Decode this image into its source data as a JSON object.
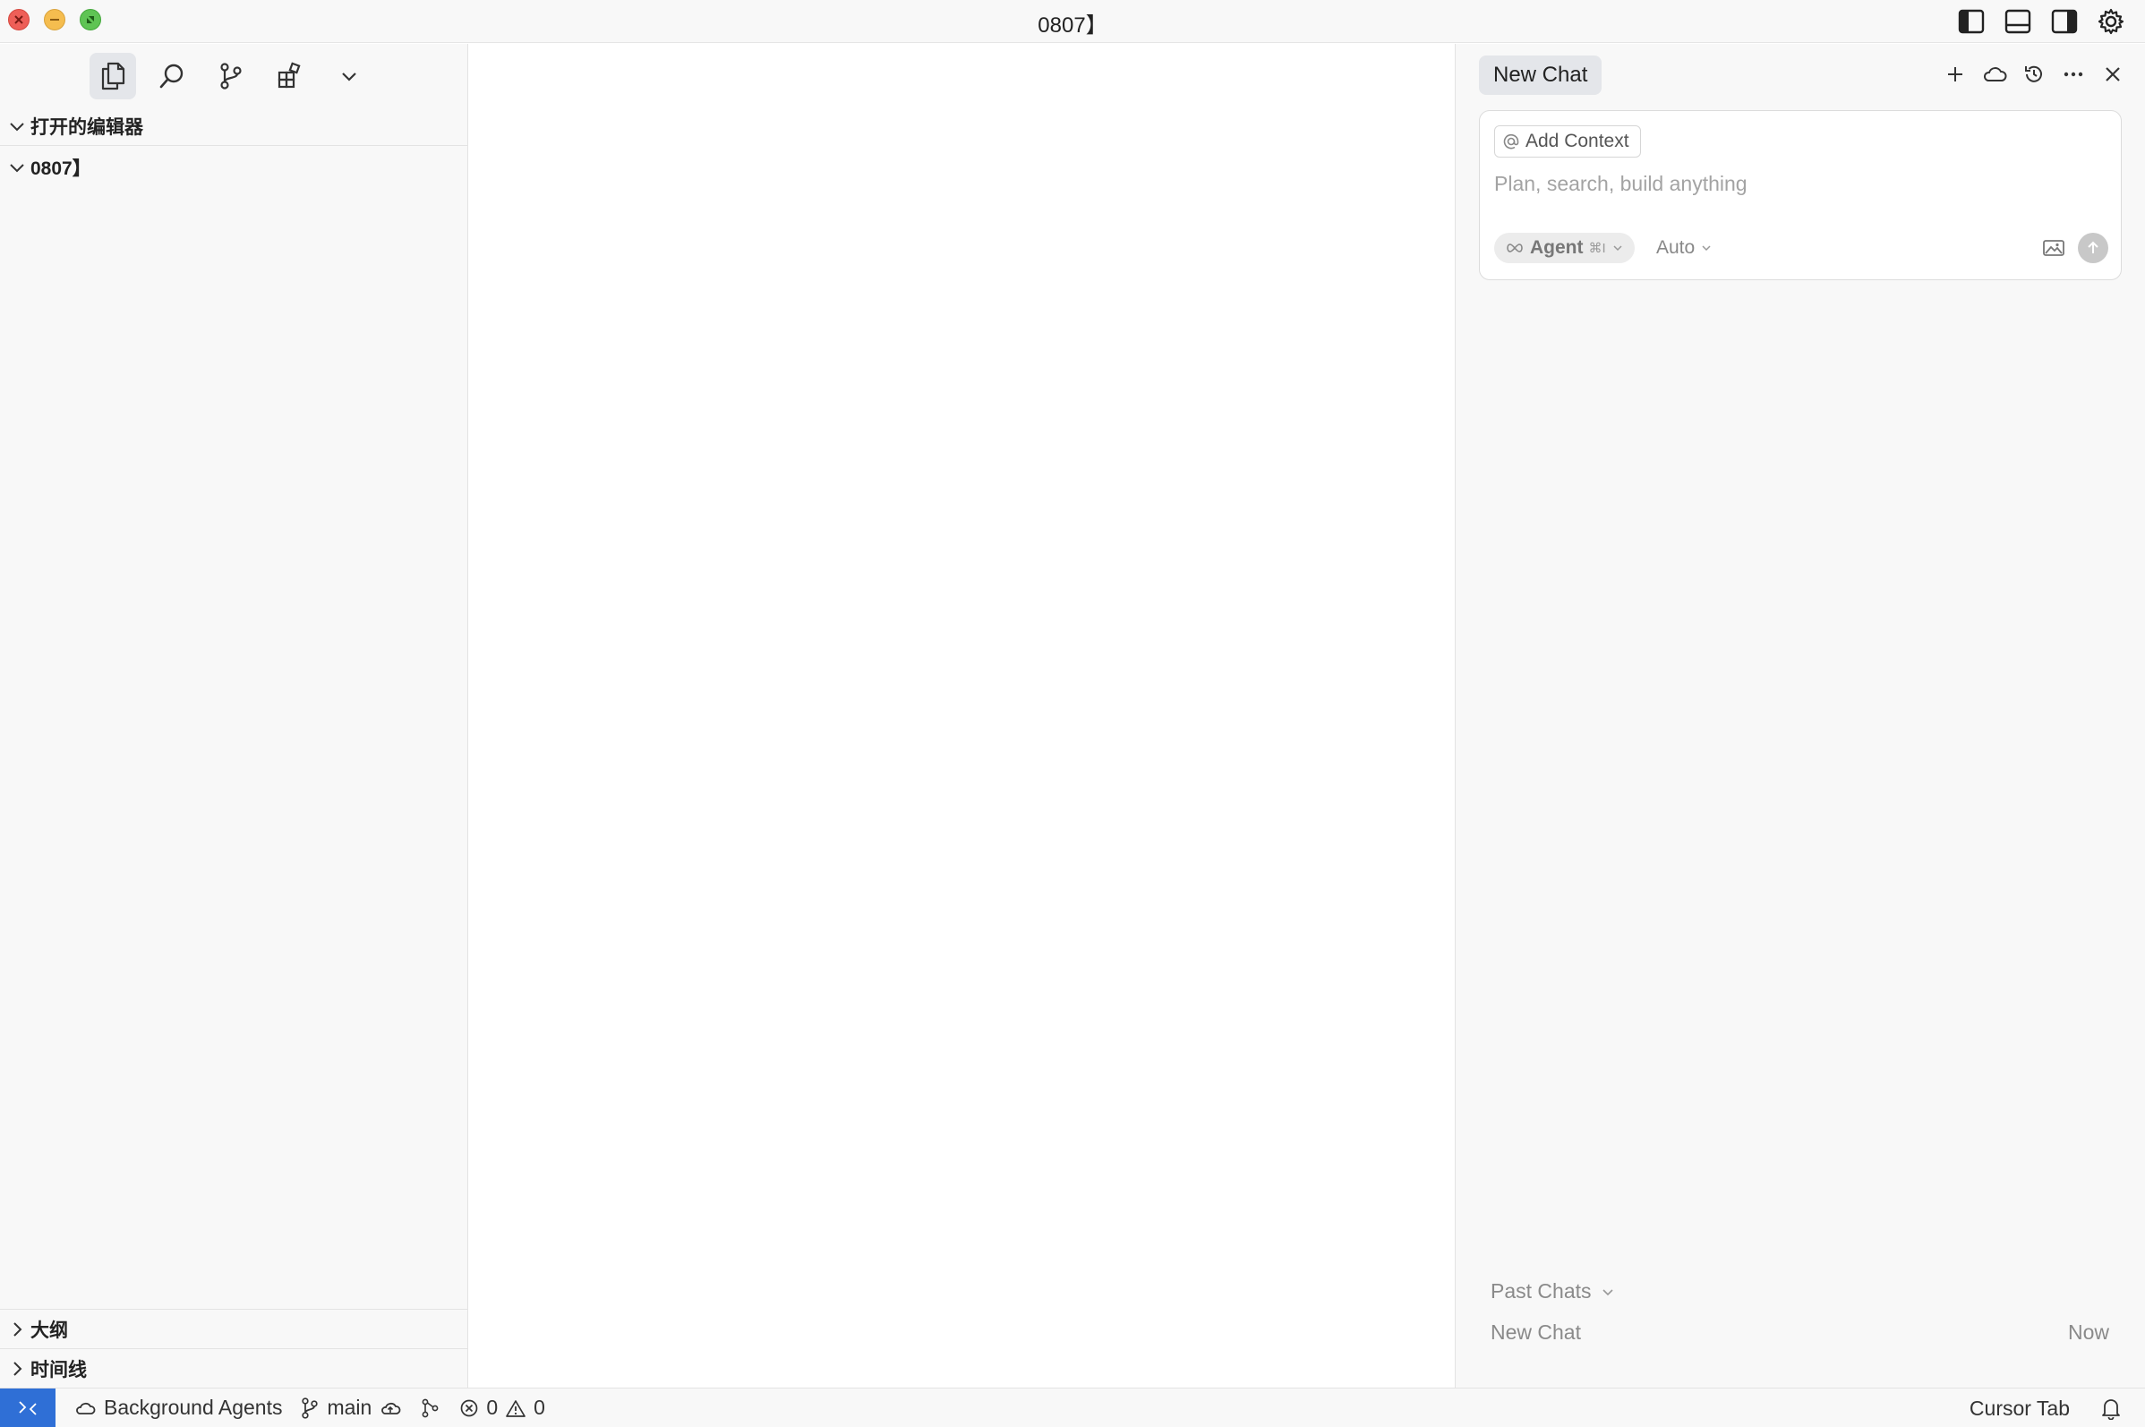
{
  "window": {
    "title": "0807】"
  },
  "sidebar": {
    "activity_icons": [
      "files-icon",
      "search-icon",
      "source-control-icon",
      "extensions-icon",
      "chevron-down-icon"
    ],
    "sections": {
      "open_editors": "打开的编辑器",
      "folder": "0807】",
      "outline": "大纲",
      "timeline": "时间线"
    }
  },
  "chat": {
    "tab_label": "New Chat",
    "add_context_label": "Add Context",
    "input_placeholder": "Plan, search, build anything",
    "agent_label": "Agent",
    "agent_shortcut": "⌘I",
    "model_label": "Auto",
    "past_chats_label": "Past Chats",
    "past_items": [
      {
        "title": "New Chat",
        "time": "Now"
      }
    ]
  },
  "statusbar": {
    "background_agents": "Background Agents",
    "branch": "main",
    "errors": "0",
    "warnings": "0",
    "cursor_tab": "Cursor Tab"
  },
  "colors": {
    "accent": "#2f6fd6",
    "panel_bg": "#f8f8f8",
    "close": "#ee5f58",
    "minimize": "#f5bd4f",
    "maximize": "#5fc454"
  }
}
